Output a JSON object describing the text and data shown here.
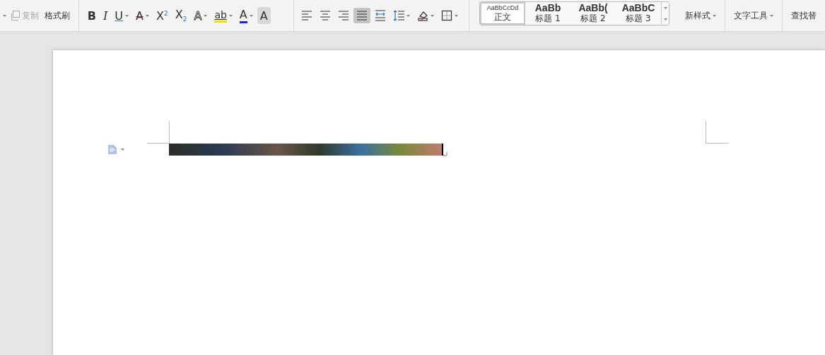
{
  "toolbar": {
    "clipboard": [
      {
        "label": "复制",
        "disabled": true
      },
      {
        "label": "格式刷",
        "disabled": false
      }
    ],
    "font_buttons": [
      {
        "kind": "bold",
        "label": "B",
        "dropdown": false
      },
      {
        "kind": "italic",
        "label": "I",
        "dropdown": false
      },
      {
        "kind": "underline",
        "label": "U",
        "dropdown": true
      },
      {
        "kind": "strike",
        "label": "A",
        "dropdown": true
      },
      {
        "kind": "script",
        "label": "X$^{2}$",
        "dropdown": false
      },
      {
        "kind": "script",
        "label": "X$_{2}$",
        "dropdown": false
      },
      {
        "kind": "outline",
        "label": "A",
        "dropdown": true
      },
      {
        "kind": "highlight",
        "label": "ab",
        "dropdown": true
      },
      {
        "kind": "color",
        "label": "A",
        "dropdown": true
      },
      {
        "kind": "shade",
        "label": "A",
        "dropdown": false
      }
    ],
    "paragraph_buttons": [
      {
        "kind": "align-left",
        "selected": false,
        "dropdown": false
      },
      {
        "kind": "align-center",
        "selected": false,
        "dropdown": false
      },
      {
        "kind": "align-right",
        "selected": false,
        "dropdown": false
      },
      {
        "kind": "justify",
        "selected": true,
        "dropdown": false
      },
      {
        "kind": "distribute",
        "selected": false,
        "dropdown": false
      },
      {
        "kind": "line-spacing",
        "selected": false,
        "dropdown": true
      },
      {
        "kind": "shading",
        "selected": false,
        "dropdown": true
      },
      {
        "kind": "borders",
        "selected": false,
        "dropdown": true
      }
    ],
    "styles": [
      {
        "preview": "AaBbCcDd",
        "label": "正文",
        "selected": true
      },
      {
        "preview": "AaBb",
        "label": "标题 1",
        "selected": false
      },
      {
        "preview": "AaBb(",
        "label": "标题 2",
        "selected": false
      },
      {
        "preview": "AaBbC",
        "label": "标题 3",
        "selected": false
      }
    ],
    "new_style": "新样式",
    "text_tools": "文字工具",
    "find_replace": "查找替"
  }
}
